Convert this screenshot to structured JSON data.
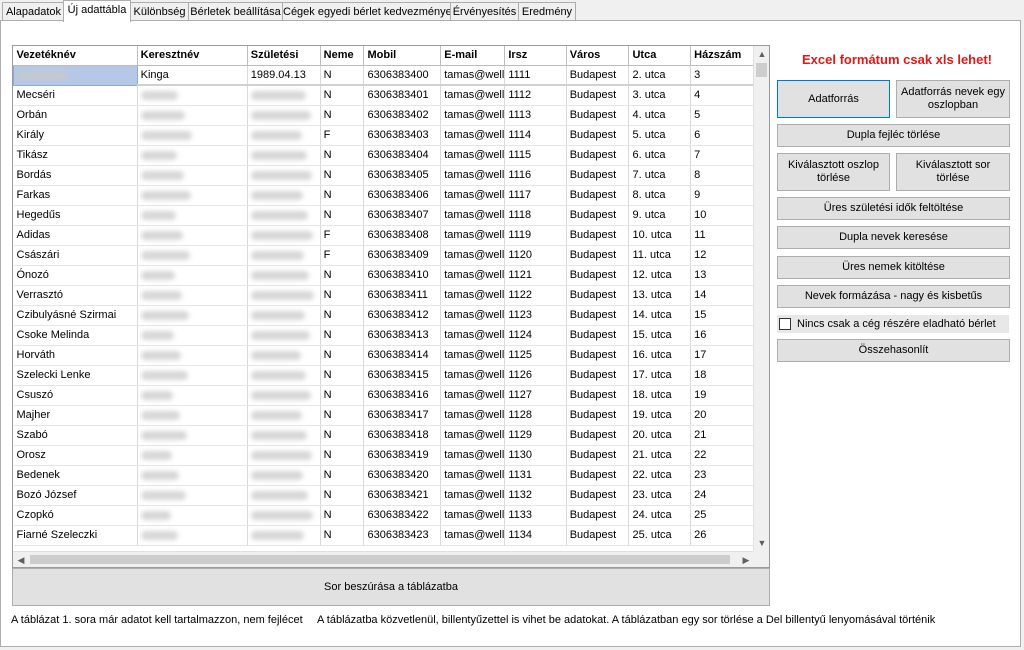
{
  "tabs": [
    "Alapadatok",
    "Új adattábla",
    "Különbség",
    "Bérletek beállítása",
    "Cégek egyedi bérlet kedvezményei",
    "Érvényesítés",
    "Eredmény"
  ],
  "grid": {
    "columns": [
      "Vezetéknév",
      "Keresztnév",
      "Születési",
      "Neme",
      "Mobil",
      "E-mail",
      "Irsz",
      "Város",
      "Utca",
      "Házszám"
    ],
    "rows": [
      [
        "",
        "Kinga",
        "1989.04.13",
        "N",
        "6306383400",
        "tamas@well",
        "1111",
        "Budapest",
        "2. utca",
        "3"
      ],
      [
        "Mecséri",
        "",
        "",
        "N",
        "6306383401",
        "tamas@well",
        "1112",
        "Budapest",
        "3. utca",
        "4"
      ],
      [
        "Orbán",
        "",
        "",
        "N",
        "6306383402",
        "tamas@well",
        "1113",
        "Budapest",
        "4. utca",
        "5"
      ],
      [
        "Király",
        "",
        "",
        "F",
        "6306383403",
        "tamas@well",
        "1114",
        "Budapest",
        "5. utca",
        "6"
      ],
      [
        "Tikász",
        "",
        "",
        "N",
        "6306383404",
        "tamas@well",
        "1115",
        "Budapest",
        "6. utca",
        "7"
      ],
      [
        "Bordás",
        "",
        "",
        "N",
        "6306383405",
        "tamas@well",
        "1116",
        "Budapest",
        "7. utca",
        "8"
      ],
      [
        "Farkas",
        "",
        "",
        "N",
        "6306383406",
        "tamas@well",
        "1117",
        "Budapest",
        "8. utca",
        "9"
      ],
      [
        "Hegedűs",
        "",
        "",
        "N",
        "6306383407",
        "tamas@well",
        "1118",
        "Budapest",
        "9. utca",
        "10"
      ],
      [
        "Adidas",
        "",
        "",
        "F",
        "6306383408",
        "tamas@well",
        "1119",
        "Budapest",
        "10. utca",
        "11"
      ],
      [
        "Császári",
        "",
        "",
        "F",
        "6306383409",
        "tamas@well",
        "1120",
        "Budapest",
        "11. utca",
        "12"
      ],
      [
        "Ónozó",
        "",
        "",
        "N",
        "6306383410",
        "tamas@well",
        "1121",
        "Budapest",
        "12. utca",
        "13"
      ],
      [
        "Verrasztó",
        "",
        "",
        "N",
        "6306383411",
        "tamas@well",
        "1122",
        "Budapest",
        "13. utca",
        "14"
      ],
      [
        "Czibulyásné Szirmai",
        "",
        "",
        "N",
        "6306383412",
        "tamas@well",
        "1123",
        "Budapest",
        "14. utca",
        "15"
      ],
      [
        "Csoke Melinda",
        "",
        "",
        "N",
        "6306383413",
        "tamas@well",
        "1124",
        "Budapest",
        "15. utca",
        "16"
      ],
      [
        "Horváth",
        "",
        "",
        "N",
        "6306383414",
        "tamas@well",
        "1125",
        "Budapest",
        "16. utca",
        "17"
      ],
      [
        "Szelecki Lenke",
        "",
        "",
        "N",
        "6306383415",
        "tamas@well",
        "1126",
        "Budapest",
        "17. utca",
        "18"
      ],
      [
        "Csuszó",
        "",
        "",
        "N",
        "6306383416",
        "tamas@well",
        "1127",
        "Budapest",
        "18. utca",
        "19"
      ],
      [
        "Majher",
        "",
        "",
        "N",
        "6306383417",
        "tamas@well",
        "1128",
        "Budapest",
        "19. utca",
        "20"
      ],
      [
        "Szabó",
        "",
        "",
        "N",
        "6306383418",
        "tamas@well",
        "1129",
        "Budapest",
        "20. utca",
        "21"
      ],
      [
        "Orosz",
        "",
        "",
        "N",
        "6306383419",
        "tamas@well",
        "1130",
        "Budapest",
        "21. utca",
        "22"
      ],
      [
        "Bedenek",
        "",
        "",
        "N",
        "6306383420",
        "tamas@well",
        "1131",
        "Budapest",
        "22. utca",
        "23"
      ],
      [
        "Bozó József",
        "",
        "",
        "N",
        "6306383421",
        "tamas@well",
        "1132",
        "Budapest",
        "23. utca",
        "24"
      ],
      [
        "Czopkó",
        "",
        "",
        "N",
        "6306383422",
        "tamas@well",
        "1133",
        "Budapest",
        "24. utca",
        "25"
      ],
      [
        "Fiarné Szeleczki",
        "",
        "",
        "N",
        "6306383423",
        "tamas@well",
        "1134",
        "Budapest",
        "25. utca",
        "26"
      ]
    ]
  },
  "insert_row_button": "Sor beszúrása a táblázatba",
  "warning": "Excel formátum csak xls lehet!",
  "buttons": {
    "datasource": "Adatforrás",
    "datasource_names_one_column": "Adatforrás nevek egy oszlopban",
    "delete_double_header": "Dupla fejléc törlése",
    "delete_selected_column": "Kiválasztott oszlop törlése",
    "delete_selected_row": "Kiválasztott sor törlése",
    "fill_empty_birthdates": "Üres születési idők feltöltése",
    "find_duplicate_names": "Dupla nevek keresése",
    "fill_empty_genders": "Üres nemek kitöltése",
    "format_names": "Nevek formázása - nagy és kisbetűs",
    "compare": "Összehasonlít"
  },
  "checkbox_label": "Nincs csak a cég részére eladható bérlet",
  "notes": {
    "left": "A táblázat 1. sora már adatot kell tartalmazzon, nem fejlécet",
    "right": "A táblázatba közvetlenül, billentyűzettel is vihet be adatokat. A táblázatban egy sor törlése a Del billentyű lenyomásával történik"
  }
}
